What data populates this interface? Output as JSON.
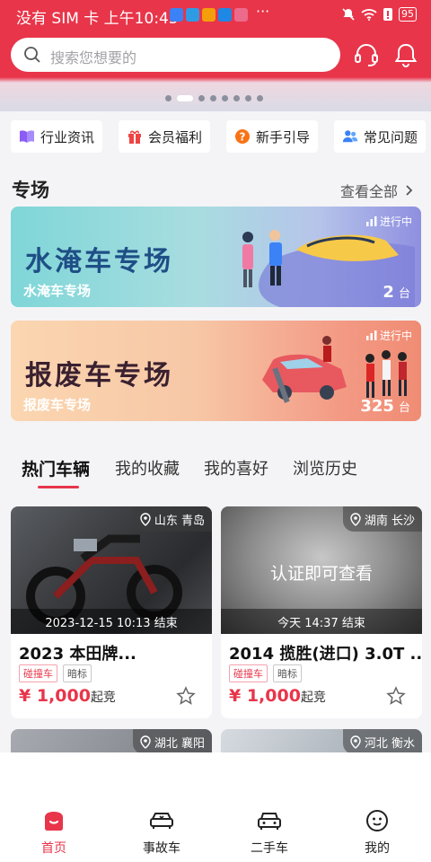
{
  "status_bar": {
    "left_text": "没有 SIM 卡 上午10:45",
    "more": "···",
    "battery": "95"
  },
  "search": {
    "placeholder": "搜索您想要的"
  },
  "header_icons": [
    "headset-icon",
    "bell-icon"
  ],
  "carousel": {
    "count": 8,
    "active_index": 1
  },
  "quick_links": [
    {
      "label": "行业资讯",
      "icon": "book-icon"
    },
    {
      "label": "会员福利",
      "icon": "gift-icon"
    },
    {
      "label": "新手引导",
      "icon": "question-icon"
    },
    {
      "label": "常见问题",
      "icon": "users-icon"
    }
  ],
  "section": {
    "title": "专场",
    "see_all": "查看全部"
  },
  "banners": [
    {
      "headline": "水淹车专场",
      "name": "水淹车专场",
      "count": "2",
      "unit": "台",
      "status": "进行中"
    },
    {
      "headline": "报废车专场",
      "name": "报废车专场",
      "count": "325",
      "unit": "台",
      "status": "进行中"
    }
  ],
  "tabs": [
    "热门车辆",
    "我的收藏",
    "我的喜好",
    "浏览历史"
  ],
  "cards": [
    {
      "location": "山东 青岛",
      "time": "2023-12-15 10:13 结束",
      "title": "2023 本田牌...",
      "tags": [
        "碰撞车",
        "暗标"
      ],
      "price": "¥ 1,000",
      "price_suffix": "起竞",
      "overlay": ""
    },
    {
      "location": "湖南 长沙",
      "time": "今天 14:37 结束",
      "title": "2014 揽胜(进口) 3.0T ...",
      "tags": [
        "碰撞车",
        "暗标"
      ],
      "price": "¥ 1,000",
      "price_suffix": "起竞",
      "overlay": "认证即可查看"
    },
    {
      "location": "湖北 襄阳"
    },
    {
      "location": "河北 衡水"
    }
  ],
  "bottom_nav": [
    {
      "label": "首页",
      "icon": "home-icon",
      "active": true
    },
    {
      "label": "事故车",
      "icon": "accident-car-icon",
      "active": false
    },
    {
      "label": "二手车",
      "icon": "used-car-icon",
      "active": false
    },
    {
      "label": "我的",
      "icon": "profile-icon",
      "active": false
    }
  ],
  "colors": {
    "accent": "#e8354a",
    "background": "#f4f4f6"
  }
}
